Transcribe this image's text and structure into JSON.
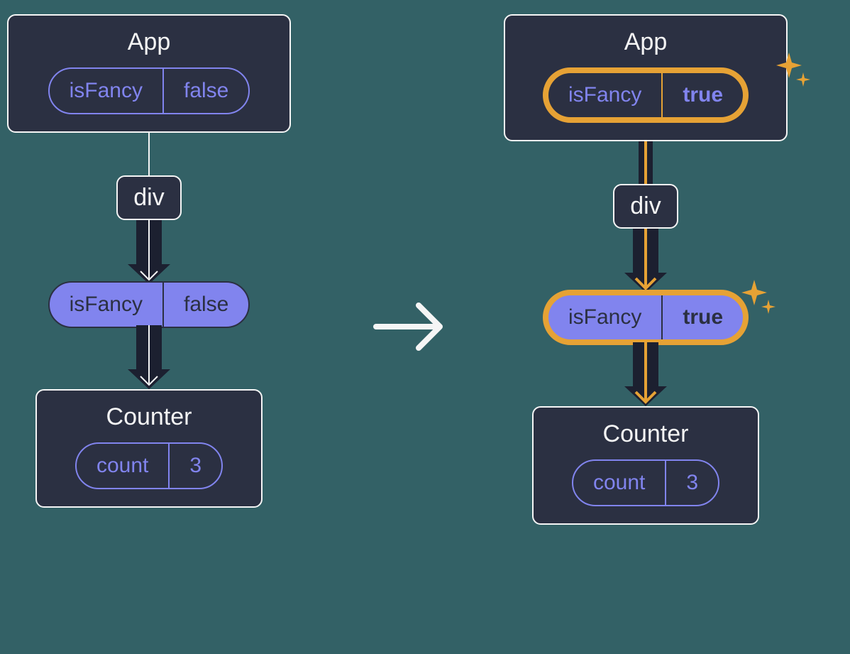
{
  "left": {
    "app": {
      "title": "App",
      "propKey": "isFancy",
      "propValue": "false"
    },
    "child": {
      "label": "div"
    },
    "passedProp": {
      "key": "isFancy",
      "value": "false"
    },
    "counter": {
      "title": "Counter",
      "stateKey": "count",
      "stateValue": "3"
    }
  },
  "right": {
    "app": {
      "title": "App",
      "propKey": "isFancy",
      "propValue": "true"
    },
    "child": {
      "label": "div"
    },
    "passedProp": {
      "key": "isFancy",
      "value": "true"
    },
    "counter": {
      "title": "Counter",
      "stateKey": "count",
      "stateValue": "3"
    }
  },
  "colors": {
    "bg": "#336166",
    "nodeBg": "#2b3042",
    "outline": "#f5f5f5",
    "purple": "#8184ee",
    "halo": "#e6a235"
  }
}
